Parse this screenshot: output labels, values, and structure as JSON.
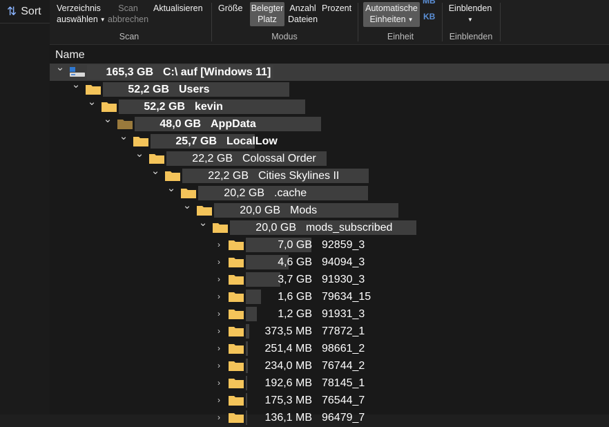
{
  "sidebar": {
    "sort_label": "Sort"
  },
  "ribbon": {
    "scan": {
      "select_dir": [
        "Verzeichnis",
        "auswählen"
      ],
      "cancel": [
        "Scan",
        "abbrechen"
      ],
      "refresh": "Aktualisieren",
      "group": "Scan"
    },
    "mode": {
      "size": "Größe",
      "allocated": [
        "Belegter",
        "Platz"
      ],
      "file_count": [
        "Anzahl",
        "Dateien"
      ],
      "percent": "Prozent",
      "group": "Modus"
    },
    "unit": {
      "auto": [
        "Automatische",
        "Einheiten"
      ],
      "mb": "MB",
      "kb": "KB",
      "group": "Einheit"
    },
    "show": {
      "show": "Einblenden",
      "group": "Einblenden"
    }
  },
  "tree": {
    "column_name": "Name",
    "rows": [
      {
        "size": "165,3 GB",
        "name": "C:\\  auf  [Windows 11]",
        "bold": true,
        "depth": 0,
        "expanded": true,
        "icon": "drive-icon",
        "fraction": 1.0,
        "selected": true
      },
      {
        "size": "52,2 GB",
        "name": "Users",
        "bold": true,
        "depth": 1,
        "expanded": true,
        "icon": "folder-icon",
        "fraction": 1.0
      },
      {
        "size": "52,2 GB",
        "name": "kevin",
        "bold": true,
        "depth": 2,
        "expanded": true,
        "icon": "folder-icon",
        "fraction": 1.0
      },
      {
        "size": "48,0 GB",
        "name": "AppData",
        "bold": true,
        "depth": 3,
        "expanded": true,
        "icon": "folder-dim-icon",
        "fraction": 1.0
      },
      {
        "size": "25,7 GB",
        "name": "LocalLow",
        "bold": true,
        "depth": 4,
        "expanded": true,
        "icon": "folder-icon",
        "fraction": 0.56
      },
      {
        "size": "22,2 GB",
        "name": "Colossal Order",
        "bold": false,
        "depth": 5,
        "expanded": true,
        "icon": "folder-icon",
        "fraction": 0.86
      },
      {
        "size": "22,2 GB",
        "name": "Cities Skylines II",
        "bold": false,
        "depth": 6,
        "expanded": true,
        "icon": "folder-icon",
        "fraction": 1.0
      },
      {
        "size": "20,2 GB",
        "name": ".cache",
        "bold": false,
        "depth": 7,
        "expanded": true,
        "icon": "folder-icon",
        "fraction": 0.91
      },
      {
        "size": "20,0 GB",
        "name": "Mods",
        "bold": false,
        "depth": 8,
        "expanded": true,
        "icon": "folder-icon",
        "fraction": 0.99
      },
      {
        "size": "20,0 GB",
        "name": "mods_subscribed",
        "bold": false,
        "depth": 9,
        "expanded": true,
        "icon": "folder-icon",
        "fraction": 1.0
      },
      {
        "size": "7,0 GB",
        "name": "92859_3",
        "bold": false,
        "depth": 10,
        "expanded": false,
        "icon": "folder-icon",
        "fraction": 0.35
      },
      {
        "size": "4,6 GB",
        "name": "94094_3",
        "bold": false,
        "depth": 10,
        "expanded": false,
        "icon": "folder-icon",
        "fraction": 0.23
      },
      {
        "size": "3,7 GB",
        "name": "91930_3",
        "bold": false,
        "depth": 10,
        "expanded": false,
        "icon": "folder-icon",
        "fraction": 0.185
      },
      {
        "size": "1,6 GB",
        "name": "79634_15",
        "bold": false,
        "depth": 10,
        "expanded": false,
        "icon": "folder-icon",
        "fraction": 0.08
      },
      {
        "size": "1,2 GB",
        "name": "91931_3",
        "bold": false,
        "depth": 10,
        "expanded": false,
        "icon": "folder-icon",
        "fraction": 0.06
      },
      {
        "size": "373,5 MB",
        "name": "77872_1",
        "bold": false,
        "depth": 10,
        "expanded": false,
        "icon": "folder-icon",
        "fraction": 0.018
      },
      {
        "size": "251,4 MB",
        "name": "98661_2",
        "bold": false,
        "depth": 10,
        "expanded": false,
        "icon": "folder-icon",
        "fraction": 0.012
      },
      {
        "size": "234,0 MB",
        "name": "76744_2",
        "bold": false,
        "depth": 10,
        "expanded": false,
        "icon": "folder-icon",
        "fraction": 0.011
      },
      {
        "size": "192,6 MB",
        "name": "78145_1",
        "bold": false,
        "depth": 10,
        "expanded": false,
        "icon": "folder-icon",
        "fraction": 0.009
      },
      {
        "size": "175,3 MB",
        "name": "76544_7",
        "bold": false,
        "depth": 10,
        "expanded": false,
        "icon": "folder-icon",
        "fraction": 0.008
      },
      {
        "size": "136,1 MB",
        "name": "96479_7",
        "bold": false,
        "depth": 10,
        "expanded": false,
        "icon": "folder-icon",
        "fraction": 0.006
      }
    ]
  },
  "colors": {
    "folder": "#f4c45a",
    "folder_dim": "#9a7a3c",
    "bar": "#3e3e3e",
    "accent": "#5b8fd6"
  }
}
